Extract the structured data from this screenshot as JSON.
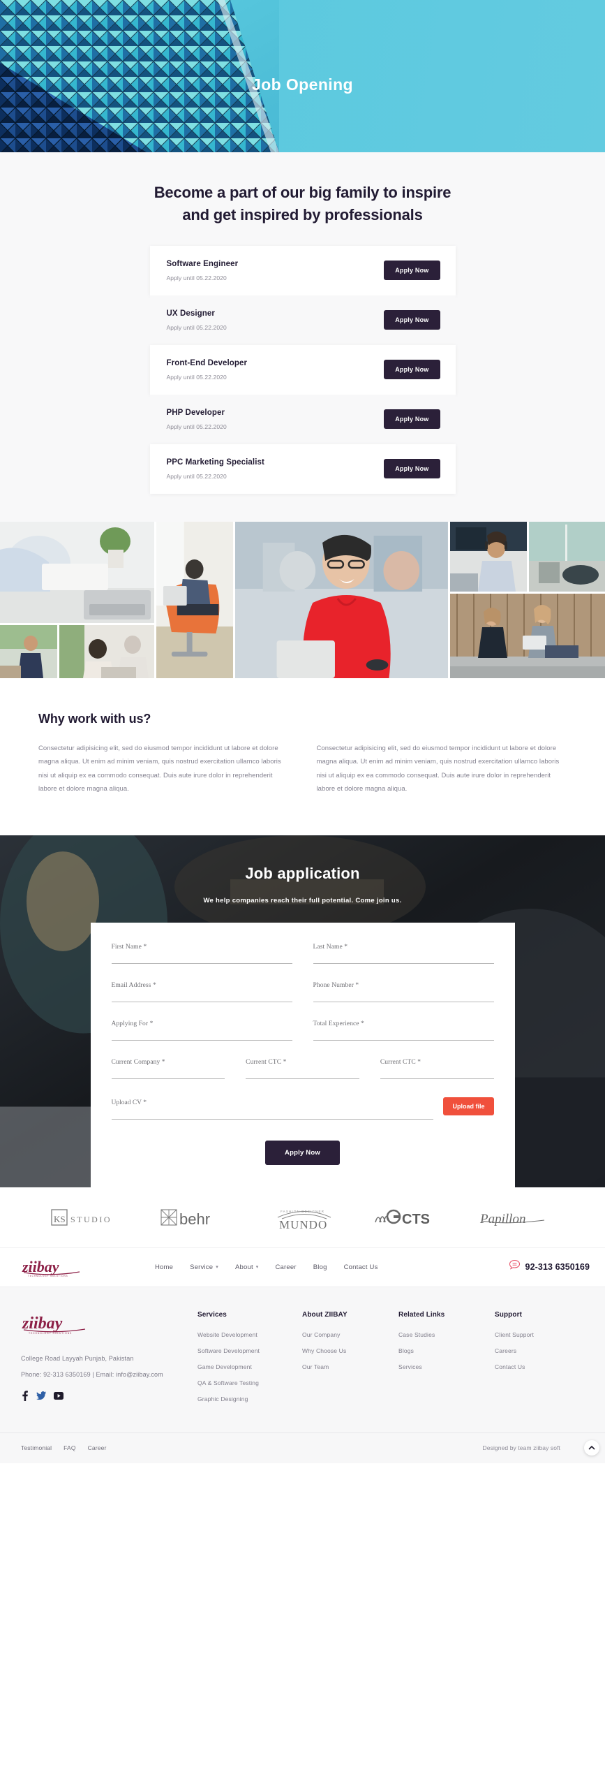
{
  "hero": {
    "title": "Job Opening"
  },
  "jobs_section": {
    "heading_line1": "Become a part of our big family to inspire",
    "heading_line2": "and get inspired by professionals",
    "apply_label": "Apply Now",
    "jobs": [
      {
        "title": "Software Engineer",
        "deadline": "Apply until 05.22.2020",
        "apply_label": "Apply Now"
      },
      {
        "title": "UX Designer",
        "deadline": "Apply until 05.22.2020",
        "apply_label": "Apply Now"
      },
      {
        "title": "Front-End Developer",
        "deadline": "Apply until 05.22.2020",
        "apply_label": "Apply Now"
      },
      {
        "title": "PHP Developer",
        "deadline": "Apply until 05.22.2020",
        "apply_label": "Apply Now"
      },
      {
        "title": "PPC Marketing Specialist",
        "deadline": "Apply until 05.22.2020",
        "apply_label": "Apply Now"
      }
    ]
  },
  "why": {
    "heading": "Why work with us?",
    "paragraph_left": "Consectetur adipisicing elit, sed do eiusmod tempor incididunt ut labore et dolore magna aliqua. Ut enim ad minim veniam, quis nostrud exercitation ullamco laboris nisi ut aliquip ex ea commodo consequat. Duis aute irure dolor in reprehenderit labore et dolore magna aliqua.",
    "paragraph_right": "Consectetur adipisicing elit, sed do eiusmod tempor incididunt ut labore et dolore magna aliqua. Ut enim ad minim veniam, quis nostrud exercitation ullamco laboris nisi ut aliquip ex ea commodo consequat. Duis aute irure dolor in reprehenderit labore et dolore magna aliqua."
  },
  "application": {
    "title": "Job application",
    "subtitle": "We help companies reach their full potential. Come join us.",
    "fields": {
      "first_name": "First Name *",
      "last_name": "Last Name *",
      "email": "Email Address *",
      "phone": "Phone Number *",
      "applying_for": "Applying For *",
      "total_experience": "Total Experience *",
      "current_company": "Current Company *",
      "current_ctc": "Current CTC *",
      "current_ctc_2": "Current CTC *",
      "upload_cv": "Upload CV *"
    },
    "upload_button": "Upload file",
    "submit_button": "Apply Now",
    "accent_color": "#f0503c",
    "submit_color": "#2b2039"
  },
  "client_logos": [
    {
      "name": "KS STUDIO"
    },
    {
      "name": "behr"
    },
    {
      "name": "MUNDO"
    },
    {
      "name": "CTS"
    },
    {
      "name": "Papillon"
    }
  ],
  "navbar": {
    "brand": "ziibay",
    "links": [
      {
        "label": "Home",
        "has_dropdown": false
      },
      {
        "label": "Service",
        "has_dropdown": true
      },
      {
        "label": "About",
        "has_dropdown": true
      },
      {
        "label": "Career",
        "has_dropdown": false
      },
      {
        "label": "Blog",
        "has_dropdown": false
      },
      {
        "label": "Contact Us",
        "has_dropdown": false
      }
    ],
    "phone": "92-313 6350169"
  },
  "footer": {
    "brand": "ziibay",
    "address": "College Road Layyah Punjab, Pakistan",
    "contact": "Phone: 92-313 6350169 | Email: info@ziibay.com",
    "socials": [
      "facebook-icon",
      "twitter-icon",
      "youtube-icon"
    ],
    "columns": [
      {
        "title": "Services",
        "links": [
          "Website Development",
          "Software Development",
          "Game Development",
          "QA & Software Testing",
          "Graphic Designing"
        ]
      },
      {
        "title": "About ZIIBAY",
        "links": [
          "Our Company",
          "Why Choose Us",
          "Our Team"
        ]
      },
      {
        "title": "Related Links",
        "links": [
          "Case Studies",
          "Blogs",
          "Services"
        ]
      },
      {
        "title": "Support",
        "links": [
          "Client Support",
          "Careers",
          "Contact Us"
        ]
      }
    ]
  },
  "bottombar": {
    "links": [
      "Testimonial",
      "FAQ",
      "Career"
    ],
    "credit": "Designed by team ziibay soft"
  }
}
